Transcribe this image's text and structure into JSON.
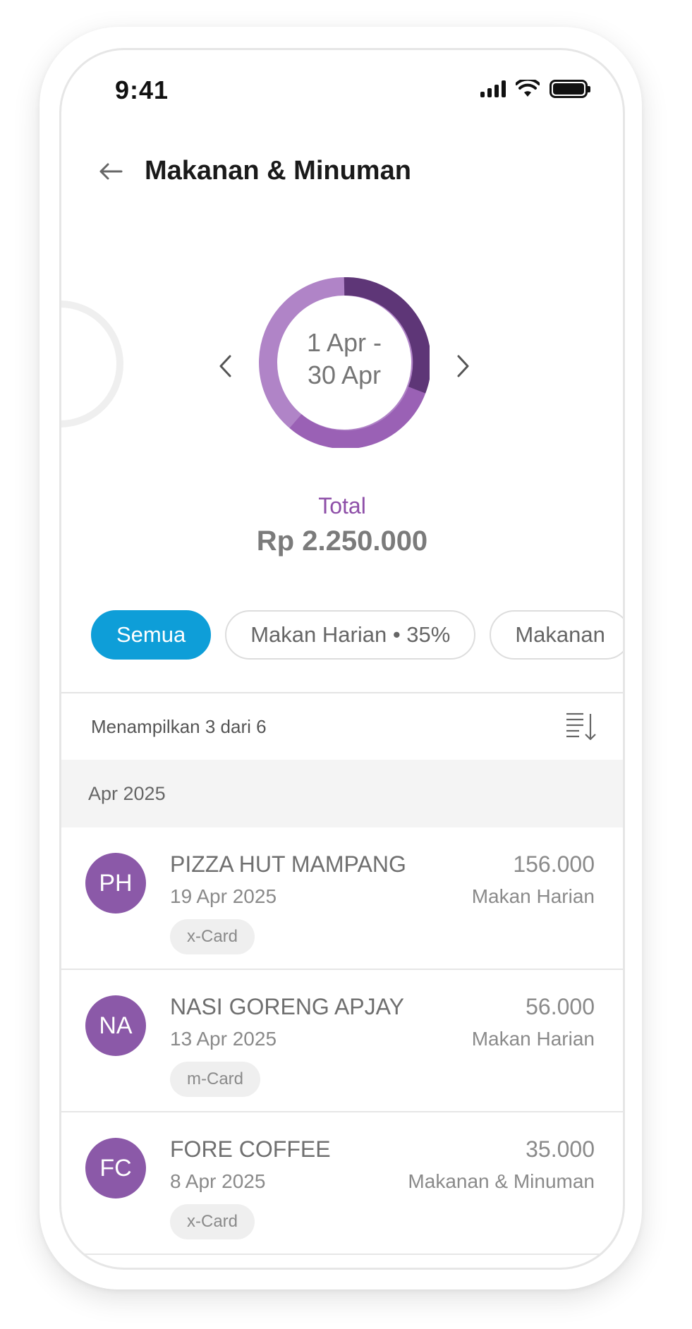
{
  "status_bar": {
    "time": "9:41"
  },
  "header": {
    "title": "Makanan & Minuman"
  },
  "summary": {
    "period_line1": "1 Apr -",
    "period_line2": "30 Apr",
    "total_label": "Total",
    "total_amount": "Rp 2.250.000"
  },
  "colors": {
    "accent_blue": "#0e9ed8",
    "purple_dark": "#5e3677",
    "purple_mid": "#9a61b5",
    "purple_light": "#b084c7",
    "avatar_purple": "#8b59a8"
  },
  "filters": [
    {
      "label": "Semua",
      "active": true
    },
    {
      "label": "Makan Harian • 35%",
      "active": false
    },
    {
      "label": "Makanan",
      "active": false
    }
  ],
  "list": {
    "count_text": "Menampilkan 3 dari 6",
    "month": "Apr 2025",
    "transactions": [
      {
        "initials": "PH",
        "merchant": "PIZZA HUT MAMPANG",
        "date": "19 Apr 2025",
        "card": "x-Card",
        "amount": "156.000",
        "category": "Makan Harian"
      },
      {
        "initials": "NA",
        "merchant": "NASI GORENG APJAY",
        "date": "13 Apr 2025",
        "card": "m-Card",
        "amount": "56.000",
        "category": "Makan Harian"
      },
      {
        "initials": "FC",
        "merchant": "FORE COFFEE",
        "date": "8 Apr 2025",
        "card": "x-Card",
        "amount": "35.000",
        "category": "Makanan & Minuman"
      }
    ]
  },
  "icons": {
    "back": "arrow-left-icon",
    "prev": "chevron-left-icon",
    "next": "chevron-right-icon",
    "sort": "sort-descending-icon"
  }
}
